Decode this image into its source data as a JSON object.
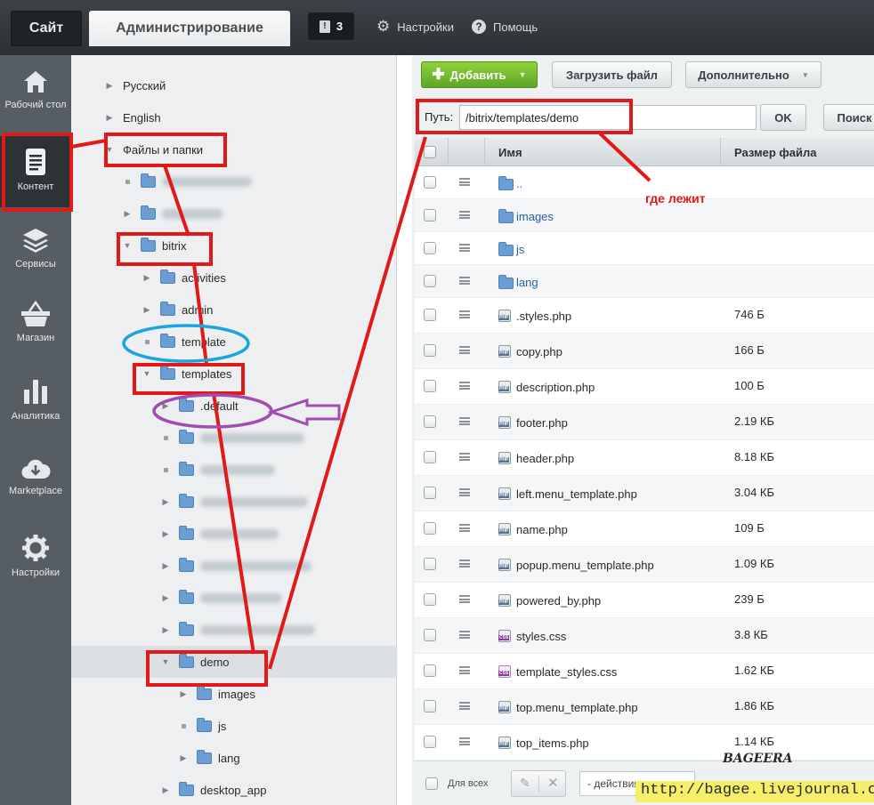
{
  "top": {
    "tab_site": "Сайт",
    "tab_admin": "Администрирование",
    "notifications": "3",
    "settings": "Настройки",
    "help": "Помощь"
  },
  "leftnav": [
    {
      "label": "Рабочий стол",
      "icon": "home-icon"
    },
    {
      "label": "Контент",
      "icon": "document-icon"
    },
    {
      "label": "Сервисы",
      "icon": "layers-icon"
    },
    {
      "label": "Магазин",
      "icon": "basket-icon"
    },
    {
      "label": "Аналитика",
      "icon": "bar-chart-icon"
    },
    {
      "label": "Marketplace",
      "icon": "cloud-download-icon"
    },
    {
      "label": "Настройки",
      "icon": "gear-icon"
    }
  ],
  "tree": [
    {
      "label": "Русский",
      "level": 0,
      "mark": "arrow-right",
      "folder": false
    },
    {
      "label": "English",
      "level": 0,
      "mark": "arrow-right",
      "folder": false
    },
    {
      "label": "Файлы и папки",
      "level": 0,
      "mark": "arrow-down",
      "folder": false
    },
    {
      "label": "",
      "level": 1,
      "mark": "dot",
      "folder": true,
      "blurred": true
    },
    {
      "label": "",
      "level": 1,
      "mark": "arrow-right",
      "folder": true,
      "blurred": true
    },
    {
      "label": "bitrix",
      "level": 1,
      "mark": "arrow-down",
      "folder": true
    },
    {
      "label": "activities",
      "level": 2,
      "mark": "arrow-right",
      "folder": true
    },
    {
      "label": "admin",
      "level": 2,
      "mark": "arrow-right",
      "folder": true
    },
    {
      "label": "template",
      "level": 2,
      "mark": "dot",
      "folder": true
    },
    {
      "label": "templates",
      "level": 2,
      "mark": "arrow-down",
      "folder": true
    },
    {
      "label": ".default",
      "level": 3,
      "mark": "arrow-right",
      "folder": true
    },
    {
      "label": "",
      "level": 3,
      "mark": "dot",
      "folder": true,
      "blurred": true
    },
    {
      "label": "",
      "level": 3,
      "mark": "dot",
      "folder": true,
      "blurred": true
    },
    {
      "label": "",
      "level": 3,
      "mark": "arrow-right",
      "folder": true,
      "blurred": true
    },
    {
      "label": "",
      "level": 3,
      "mark": "arrow-right",
      "folder": true,
      "blurred": true
    },
    {
      "label": "",
      "level": 3,
      "mark": "arrow-right",
      "folder": true,
      "blurred": true
    },
    {
      "label": "",
      "level": 3,
      "mark": "arrow-right",
      "folder": true,
      "blurred": true
    },
    {
      "label": "",
      "level": 3,
      "mark": "arrow-right",
      "folder": true,
      "blurred": true
    },
    {
      "label": "demo",
      "level": 3,
      "mark": "arrow-down",
      "folder": true,
      "selected": true
    },
    {
      "label": "images",
      "level": 4,
      "mark": "arrow-right",
      "folder": true
    },
    {
      "label": "js",
      "level": 4,
      "mark": "dot",
      "folder": true
    },
    {
      "label": "lang",
      "level": 4,
      "mark": "arrow-right",
      "folder": true
    },
    {
      "label": "desktop_app",
      "level": 3,
      "mark": "arrow-right",
      "folder": true
    }
  ],
  "toolbar": {
    "add": "Добавить",
    "upload": "Загрузить файл",
    "more": "Дополнительно"
  },
  "path": {
    "label": "Путь:",
    "value": "/bitrix/templates/demo",
    "ok": "OK",
    "search": "Поиск"
  },
  "grid": {
    "col_name": "Имя",
    "col_size": "Размер файла",
    "rows": [
      {
        "name": "..",
        "size": "",
        "type": "up"
      },
      {
        "name": "images",
        "size": "",
        "type": "folder"
      },
      {
        "name": "js",
        "size": "",
        "type": "folder"
      },
      {
        "name": "lang",
        "size": "",
        "type": "folder"
      },
      {
        "name": ".styles.php",
        "size": "746 Б",
        "type": "php"
      },
      {
        "name": "copy.php",
        "size": "166 Б",
        "type": "php"
      },
      {
        "name": "description.php",
        "size": "100 Б",
        "type": "php"
      },
      {
        "name": "footer.php",
        "size": "2.19 КБ",
        "type": "php"
      },
      {
        "name": "header.php",
        "size": "8.18 КБ",
        "type": "php"
      },
      {
        "name": "left.menu_template.php",
        "size": "3.04 КБ",
        "type": "php"
      },
      {
        "name": "name.php",
        "size": "109 Б",
        "type": "php"
      },
      {
        "name": "popup.menu_template.php",
        "size": "1.09 КБ",
        "type": "php"
      },
      {
        "name": "powered_by.php",
        "size": "239 Б",
        "type": "php"
      },
      {
        "name": "styles.css",
        "size": "3.8 КБ",
        "type": "css"
      },
      {
        "name": "template_styles.css",
        "size": "1.62 КБ",
        "type": "css"
      },
      {
        "name": "top.menu_template.php",
        "size": "1.86 КБ",
        "type": "php"
      },
      {
        "name": "top_items.php",
        "size": "1.14 КБ",
        "type": "php"
      }
    ]
  },
  "footer": {
    "for_all": "Для всех",
    "actions": "- действия -"
  },
  "annotation": {
    "where": "где лежит",
    "color": "#e11919",
    "circle_blue": "#1ba4e0",
    "circle_purple": "#a24bb0"
  },
  "watermark": "http://bagee.livejournal.com",
  "logo": "BAGEERA"
}
